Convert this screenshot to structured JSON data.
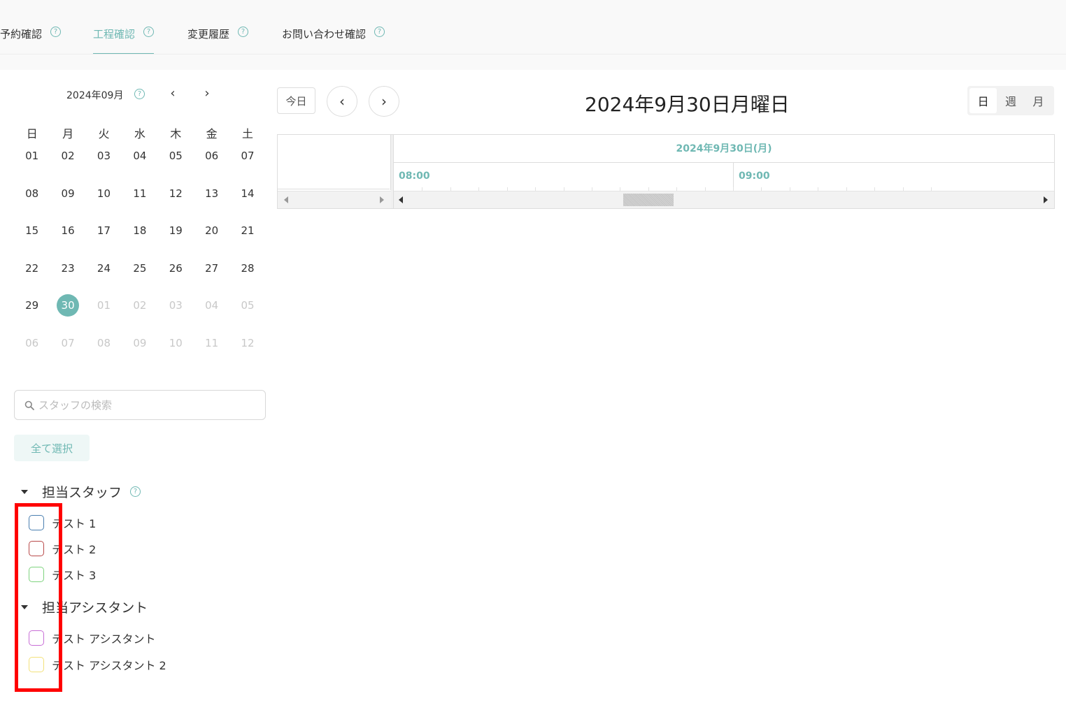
{
  "tabs": [
    {
      "label": "予約確認",
      "active": false
    },
    {
      "label": "工程確認",
      "active": true
    },
    {
      "label": "変更履歴",
      "active": false
    },
    {
      "label": "お問い合わせ確認",
      "active": false
    }
  ],
  "help_glyph": "?",
  "mini_calendar": {
    "title": "2024年09月",
    "prev": "‹",
    "next": "›",
    "weekdays": [
      "日",
      "月",
      "火",
      "水",
      "木",
      "金",
      "土"
    ],
    "weeks": [
      [
        "01",
        "02",
        "03",
        "04",
        "05",
        "06",
        "07"
      ],
      [
        "08",
        "09",
        "10",
        "11",
        "12",
        "13",
        "14"
      ],
      [
        "15",
        "16",
        "17",
        "18",
        "19",
        "20",
        "21"
      ],
      [
        "22",
        "23",
        "24",
        "25",
        "26",
        "27",
        "28"
      ],
      [
        "29",
        "30",
        "01",
        "02",
        "03",
        "04",
        "05"
      ],
      [
        "06",
        "07",
        "08",
        "09",
        "10",
        "11",
        "12"
      ]
    ],
    "selected": "30"
  },
  "search": {
    "placeholder": "スタッフの検索",
    "value": ""
  },
  "select_all_label": "全て選択",
  "groups": [
    {
      "title": "担当スタッフ",
      "has_help": true,
      "items": [
        {
          "label": "テスト 1",
          "color": "#4a7fb0",
          "checked": false
        },
        {
          "label": "テスト 2",
          "color": "#b94a4a",
          "checked": false
        },
        {
          "label": "テスト 3",
          "color": "#7ed37e",
          "checked": false
        }
      ]
    },
    {
      "title": "担当アシスタント",
      "has_help": false,
      "items": [
        {
          "label": "テスト アシスタント",
          "color": "#c86ed6",
          "checked": false
        },
        {
          "label": "テスト アシスタント 2",
          "color": "#f3e17a",
          "checked": false
        }
      ]
    }
  ],
  "schedule": {
    "today_label": "今日",
    "prev": "‹",
    "next": "›",
    "date_title": "2024年9月30日月曜日",
    "views": [
      "日",
      "週",
      "月"
    ],
    "active_view": "日",
    "day_header": "2024年9月30日(月)",
    "times": [
      "08:00",
      "09:00"
    ],
    "scroll_position": 0.37
  },
  "colors": {
    "accent": "#6fb8b3",
    "highlight": "#ff0000"
  }
}
